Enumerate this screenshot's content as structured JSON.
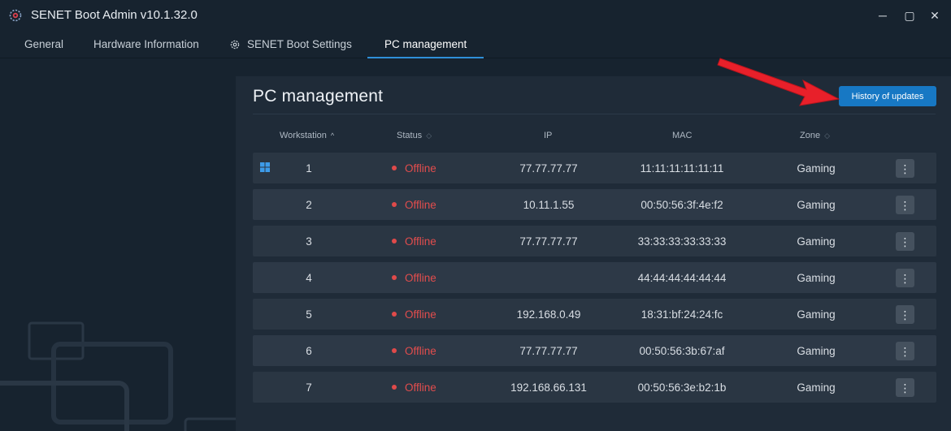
{
  "app": {
    "title": "SENET Boot Admin v10.1.32.0",
    "window_controls": {
      "minimize": "─",
      "maximize": "▢",
      "close": "✕"
    }
  },
  "tabs": [
    {
      "label": "General"
    },
    {
      "label": "Hardware Information"
    },
    {
      "label": "SENET Boot Settings",
      "icon": "gear-icon"
    },
    {
      "label": "PC management",
      "active": true
    }
  ],
  "panel": {
    "title": "PC management",
    "history_button": "History of updates"
  },
  "table": {
    "columns": {
      "workstation": "Workstation",
      "status": "Status",
      "ip": "IP",
      "mac": "MAC",
      "zone": "Zone"
    },
    "sort": {
      "workstation": "ascending"
    },
    "rows": [
      {
        "workstation": "1",
        "status": "Offline",
        "ip": "77.77.77.77",
        "mac": "11:11:11:11:11:11",
        "zone": "Gaming",
        "os": "windows-icon"
      },
      {
        "workstation": "2",
        "status": "Offline",
        "ip": "10.11.1.55",
        "mac": "00:50:56:3f:4e:f2",
        "zone": "Gaming"
      },
      {
        "workstation": "3",
        "status": "Offline",
        "ip": "77.77.77.77",
        "mac": "33:33:33:33:33:33",
        "zone": "Gaming"
      },
      {
        "workstation": "4",
        "status": "Offline",
        "ip": "",
        "mac": "44:44:44:44:44:44",
        "zone": "Gaming"
      },
      {
        "workstation": "5",
        "status": "Offline",
        "ip": "192.168.0.49",
        "mac": "18:31:bf:24:24:fc",
        "zone": "Gaming"
      },
      {
        "workstation": "6",
        "status": "Offline",
        "ip": "77.77.77.77",
        "mac": "00:50:56:3b:67:af",
        "zone": "Gaming"
      },
      {
        "workstation": "7",
        "status": "Offline",
        "ip": "192.168.66.131",
        "mac": "00:50:56:3e:b2:1b",
        "zone": "Gaming"
      }
    ],
    "row_menu_glyph": "⋮"
  },
  "colors": {
    "accent": "#1778c4",
    "offline": "#e24d4d",
    "annotation_arrow": "#e8202a"
  }
}
